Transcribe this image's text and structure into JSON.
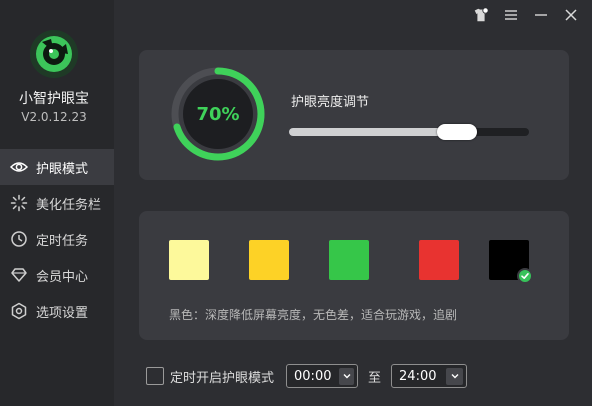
{
  "app": {
    "name": "小智护眼宝",
    "version": "V2.0.12.23"
  },
  "nav": {
    "items": [
      {
        "label": "护眼模式",
        "icon": "eye-icon",
        "active": true
      },
      {
        "label": "美化任务栏",
        "icon": "sparkle-icon",
        "active": false
      },
      {
        "label": "定时任务",
        "icon": "clock-icon",
        "active": false
      },
      {
        "label": "会员中心",
        "icon": "diamond-icon",
        "active": false
      },
      {
        "label": "选项设置",
        "icon": "gear-icon",
        "active": false
      }
    ]
  },
  "window_controls": [
    "skin-icon",
    "menu-icon",
    "minimize-icon",
    "close-icon"
  ],
  "brightness": {
    "title": "护眼亮度调节",
    "gauge_label": "70%",
    "gauge_percent": 70,
    "slider_position_percent": 70
  },
  "modes": {
    "swatches": [
      {
        "name": "light-yellow",
        "color": "#fdf99b",
        "selected": false
      },
      {
        "name": "yellow",
        "color": "#fdd226",
        "selected": false
      },
      {
        "name": "green",
        "color": "#36c649",
        "selected": false
      },
      {
        "name": "red",
        "color": "#e83330",
        "selected": false
      },
      {
        "name": "black",
        "color": "#000000",
        "selected": true
      }
    ],
    "description": "黑色：深度降低屏幕亮度，无色差，适合玩游戏，追剧"
  },
  "schedule": {
    "checkbox_label": "定时开启护眼模式",
    "checked": false,
    "start_time": "00:00",
    "to_label": "至",
    "end_time": "24:00"
  },
  "colors": {
    "accent": "#3fd25a",
    "background": "#2d2e32",
    "card": "#3a3b40",
    "sidebar": "#27282b"
  }
}
